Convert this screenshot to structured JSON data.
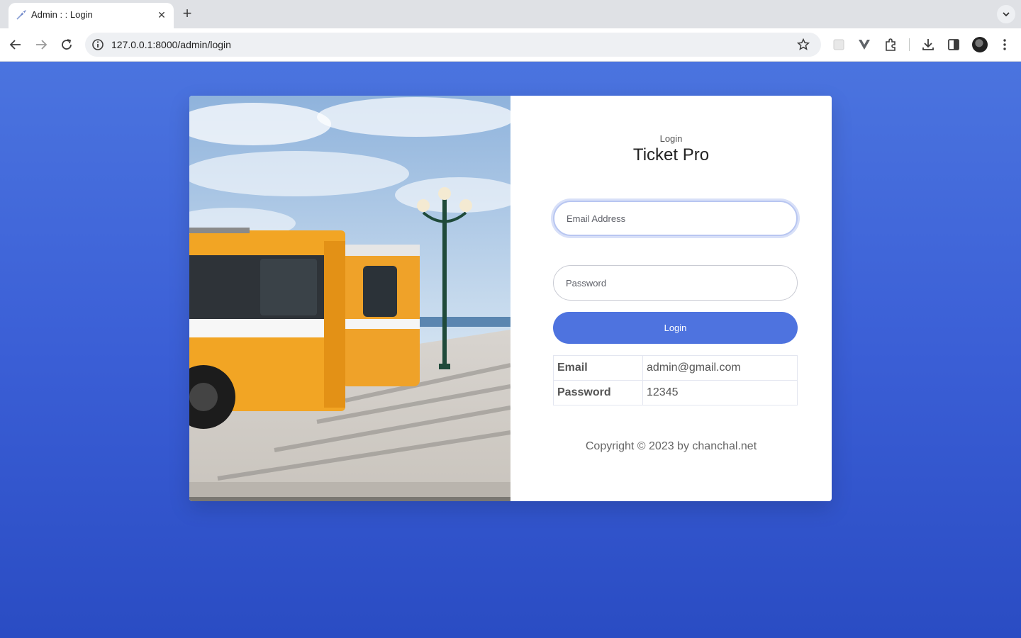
{
  "browser": {
    "tab_title": "Admin : : Login",
    "tab_close": "✕",
    "new_tab": "+",
    "url": "127.0.0.1:8000/admin/login"
  },
  "login": {
    "subtitle": "Login",
    "title": "Ticket Pro",
    "email_placeholder": "Email Address",
    "password_placeholder": "Password",
    "button_label": "Login"
  },
  "credentials": [
    {
      "key": "Email",
      "value": "admin@gmail.com"
    },
    {
      "key": "Password",
      "value": "12345"
    }
  ],
  "footer": {
    "copyright": "Copyright © 2023 by chanchal.net"
  },
  "colors": {
    "accent": "#4e73df",
    "page_bg_top": "#4b74df",
    "page_bg_bottom": "#2a4cc3"
  }
}
